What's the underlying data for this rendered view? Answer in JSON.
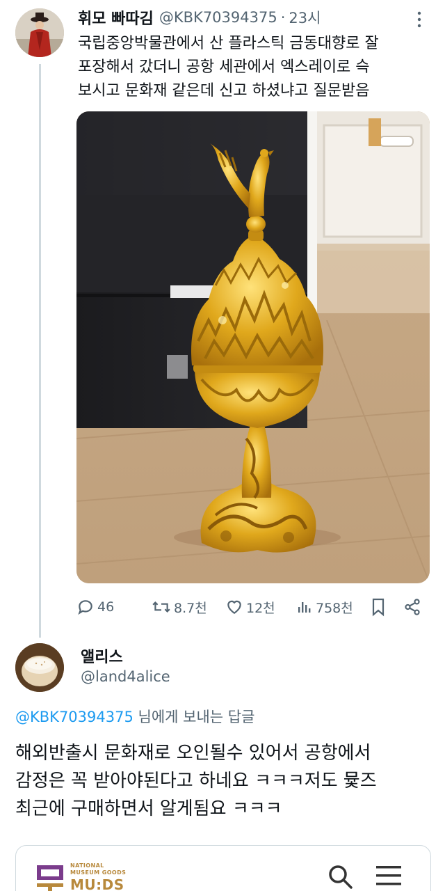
{
  "tweet": {
    "display_name": "휘모 빠따김",
    "handle": "@KBK70394375",
    "separator": "·",
    "time": "23시",
    "text_lines": [
      "국립중앙박물관에서 산 플라스틱 금동대향로 잘",
      "포장해서 갔더니 공항 세관에서 엑스레이로 슥",
      "보시고 문화재 같은데 신고 하셨냐고 질문받음"
    ],
    "actions": {
      "replies": "46",
      "retweets": "8.7천",
      "likes": "12천",
      "views": "758천"
    }
  },
  "reply": {
    "display_name": "앨리스",
    "handle": "@land4alice",
    "reply_to_mention": "@KBK70394375",
    "reply_to_suffix": " 님에게 보내는 답글",
    "text_lines": [
      "해외반출시 문화재로 오인될수 있어서 공항에서",
      "감정은 꼭 받아야된다고 하네요 ㅋㅋㅋ저도 뮻즈",
      "최근에 구매하면서 알게됨요 ㅋㅋㅋ"
    ]
  },
  "card": {
    "logo_line1": "NATIONAL",
    "logo_line2": "MUSEUM GOODS",
    "logo_text": "MU:DS"
  },
  "colors": {
    "text": "#0f1419",
    "secondary": "#536471",
    "link": "#1d9bf0",
    "border": "#cfd9de",
    "gold": "#d4a017",
    "brand_purple": "#7b3c8c",
    "brand_gold": "#b8893c"
  },
  "icons": {
    "more": "more-vertical-icon",
    "reply": "reply-icon",
    "retweet": "retweet-icon",
    "like": "heart-icon",
    "views": "views-icon",
    "bookmark": "bookmark-icon",
    "share": "share-icon",
    "search": "search-icon",
    "menu": "hamburger-menu-icon"
  }
}
